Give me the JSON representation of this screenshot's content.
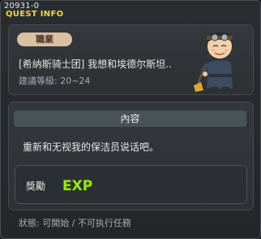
{
  "quest_id": "20931-0",
  "window_title": "QUEST INFO",
  "job_tag": "職業",
  "quest_title": "[希纳斯骑士团] 我想和埃德尔斯坦..",
  "level_label": "建議等級: 20~24",
  "section_header": "內容",
  "description": "重新和无视我的保洁员说话吧。",
  "reward_label": "獎勵",
  "reward_icon_text": "EXP",
  "status": "狀態: 可開始 / 不可执行任務",
  "colors": {
    "title": "#f2d54a",
    "tag_bg": "#d8c0a4",
    "exp_fill": "#9be21c",
    "exp_outline": "#2c4a10"
  },
  "icons": {
    "npc": "npc-sweeper-portrait",
    "exp": "exp-reward-icon"
  }
}
